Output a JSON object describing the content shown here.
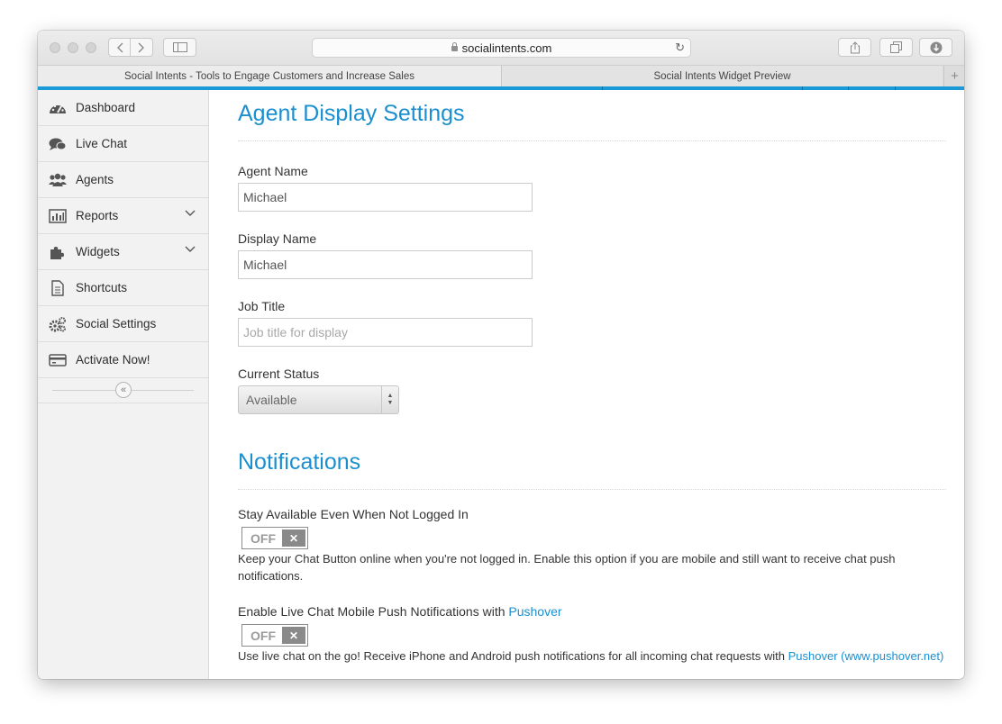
{
  "browser": {
    "url": "socialintents.com",
    "tabs": [
      {
        "label": "Social Intents - Tools to Engage Customers and Increase Sales"
      },
      {
        "label": "Social Intents Widget Preview"
      }
    ]
  },
  "sidebar": {
    "items": [
      {
        "label": "Dashboard",
        "icon": "dashboard-icon"
      },
      {
        "label": "Live Chat",
        "icon": "chat-bubbles-icon"
      },
      {
        "label": "Agents",
        "icon": "users-icon"
      },
      {
        "label": "Reports",
        "icon": "bar-chart-icon",
        "expandable": true
      },
      {
        "label": "Widgets",
        "icon": "puzzle-icon",
        "expandable": true
      },
      {
        "label": "Shortcuts",
        "icon": "document-icon"
      },
      {
        "label": "Social Settings",
        "icon": "gears-icon"
      },
      {
        "label": "Activate Now!",
        "icon": "credit-card-icon"
      }
    ]
  },
  "agent_settings": {
    "title": "Agent Display Settings",
    "agent_name_label": "Agent Name",
    "agent_name_value": "Michael",
    "display_name_label": "Display Name",
    "display_name_value": "Michael",
    "job_title_label": "Job Title",
    "job_title_value": "",
    "job_title_placeholder": "Job title for display",
    "status_label": "Current Status",
    "status_value": "Available"
  },
  "notifications": {
    "title": "Notifications",
    "stay_available": {
      "label": "Stay Available Even When Not Logged In",
      "toggle_state": "OFF",
      "description": "Keep your Chat Button online when you're not logged in. Enable this option if you are mobile and still want to receive chat push notifications."
    },
    "pushover": {
      "label_prefix": "Enable Live Chat Mobile Push Notifications with ",
      "label_link": "Pushover",
      "toggle_state": "OFF",
      "description_prefix": "Use live chat on the go! Receive iPhone and Android push notifications for all incoming chat requests with ",
      "description_link": "Pushover (www.pushover.net)"
    }
  },
  "colors": {
    "accent": "#1a8fd0",
    "tab_underline": "#1a9ad6",
    "sidebar_bg": "#f2f2f2"
  }
}
